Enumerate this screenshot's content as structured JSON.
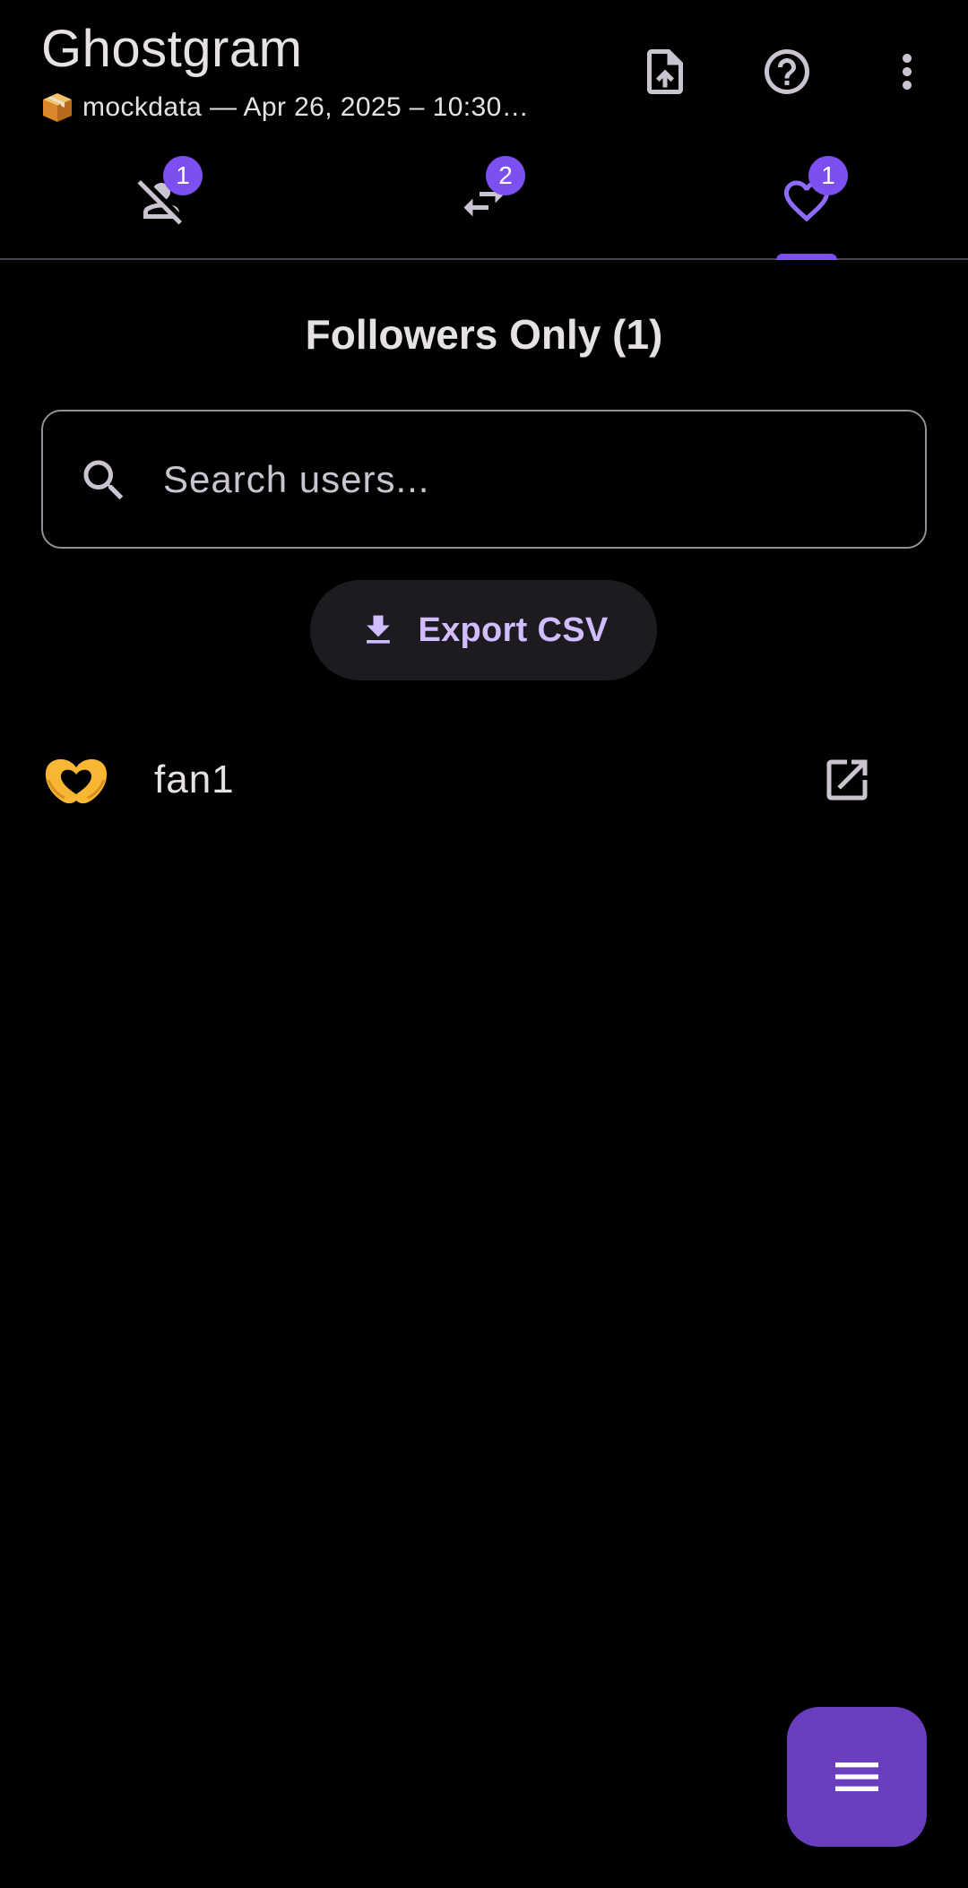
{
  "app": {
    "title": "Ghostgram",
    "subtitle": "mockdata — Apr 26, 2025 – 10:30…"
  },
  "toolbar": {
    "icons": [
      "upload-file-icon",
      "help-icon",
      "more-vert-icon"
    ]
  },
  "tabs": [
    {
      "icon": "person-off-icon",
      "badge": "1",
      "selected": false
    },
    {
      "icon": "swap-horiz-icon",
      "badge": "2",
      "selected": false
    },
    {
      "icon": "heart-icon",
      "badge": "1",
      "selected": true
    }
  ],
  "section": {
    "title": "Followers Only (1)"
  },
  "search": {
    "placeholder": "Search users...",
    "value": ""
  },
  "export": {
    "label": "Export CSV"
  },
  "users": [
    {
      "avatar": "heart-hands-emoji",
      "name": "fan1"
    }
  ],
  "fab": {
    "icon": "menu-icon"
  },
  "colors": {
    "background": "#000000",
    "accent": "#7b4ff0",
    "fab": "#6a3fbf",
    "icon": "#cac4d0",
    "text": "#e6e1e5",
    "button_text": "#d0bcff"
  }
}
